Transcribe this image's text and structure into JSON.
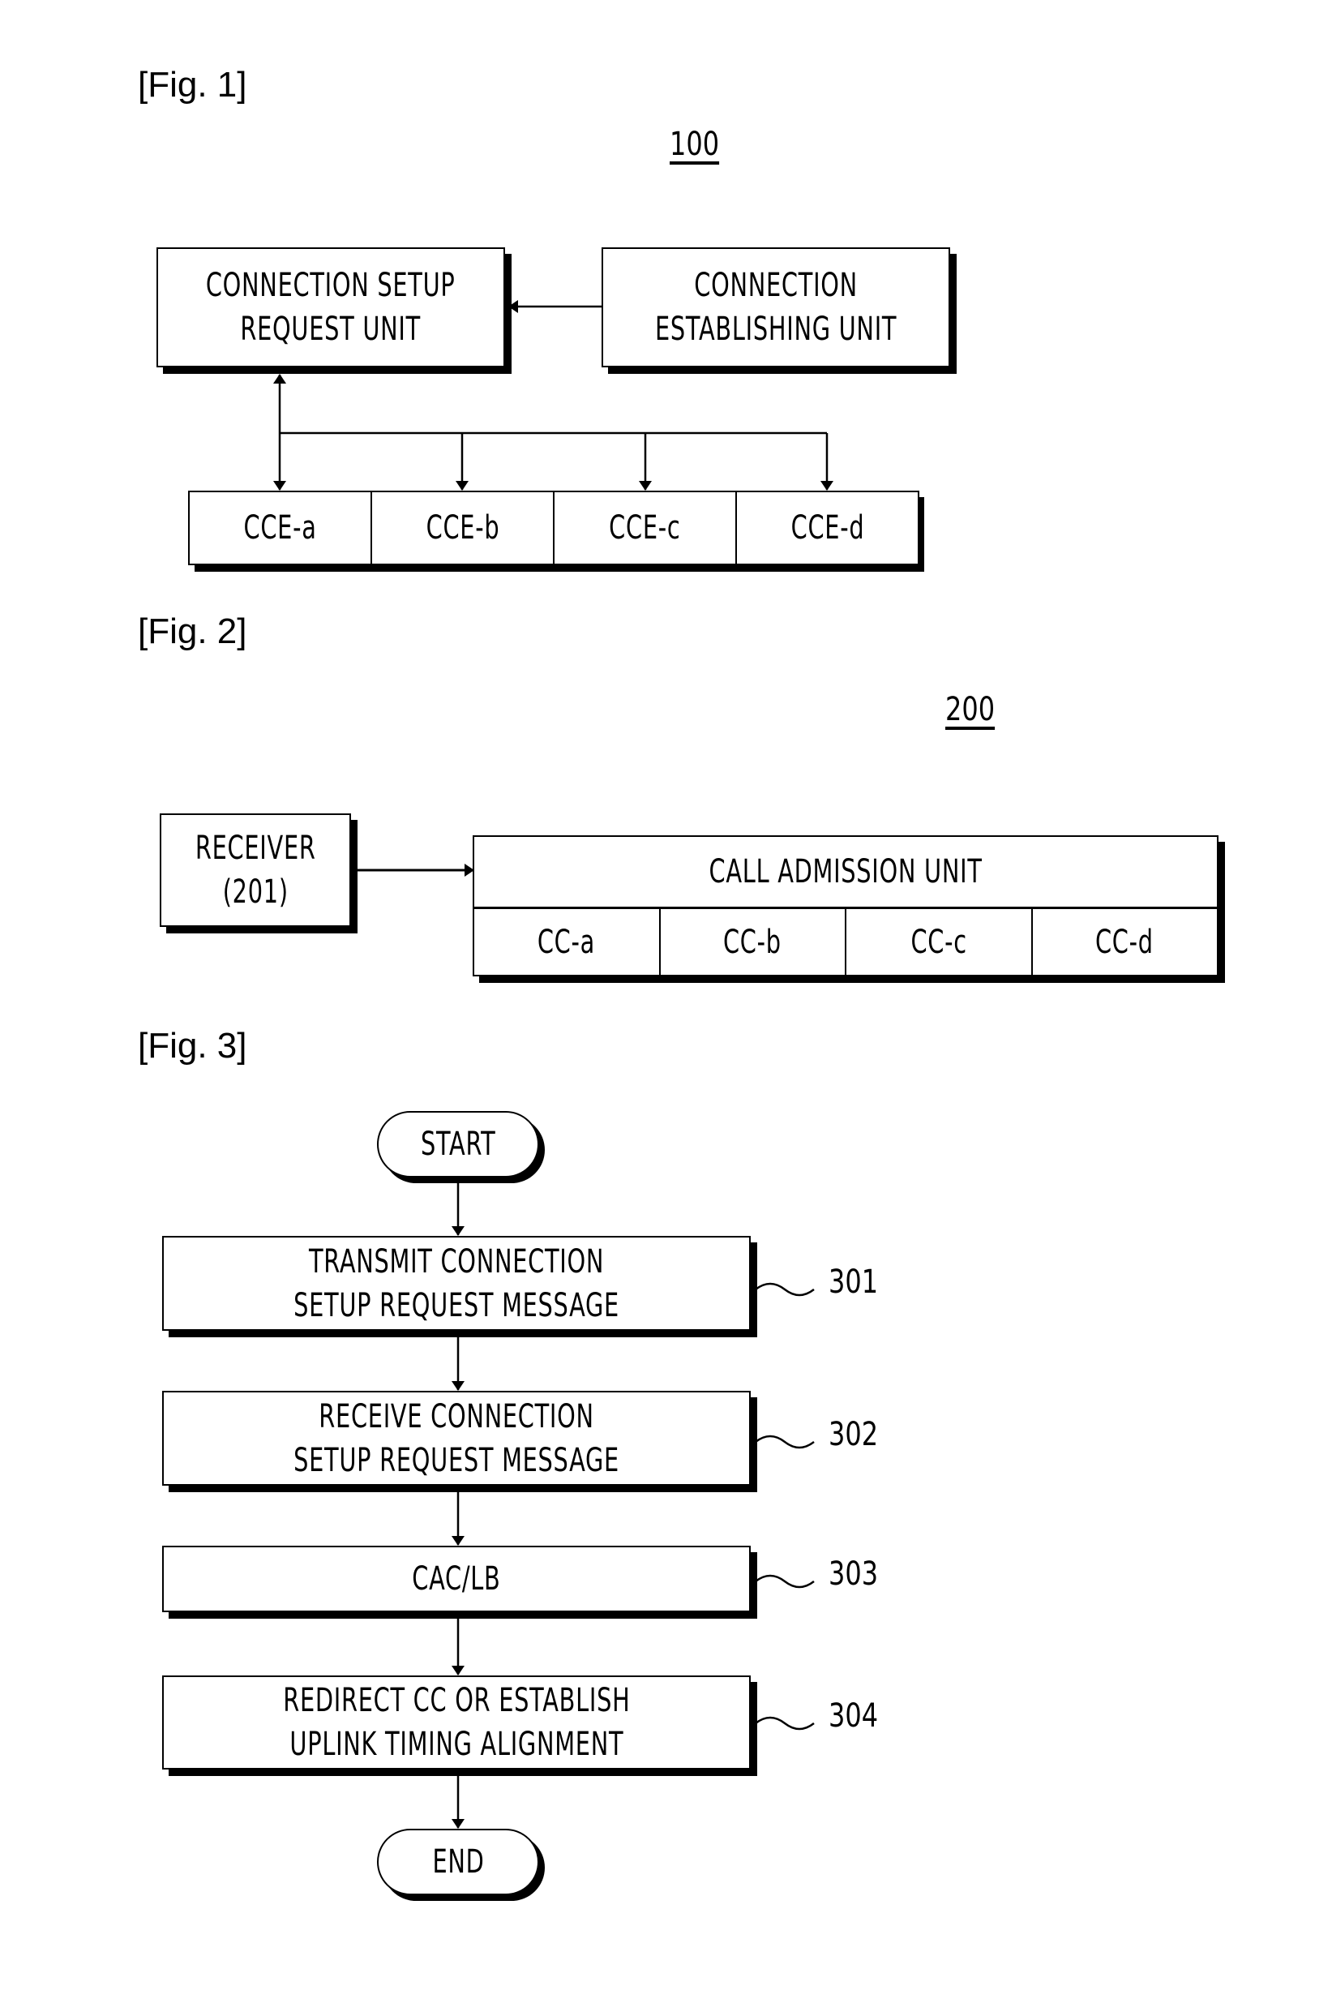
{
  "fig1": {
    "label": "[Fig. 1]",
    "ref": "100",
    "connection_setup_request_unit": [
      "CONNECTION SETUP",
      "REQUEST UNIT"
    ],
    "connection_establishing_unit": [
      "CONNECTION",
      "ESTABLISHING UNIT"
    ],
    "cces": [
      "CCE-a",
      "CCE-b",
      "CCE-c",
      "CCE-d"
    ]
  },
  "fig2": {
    "label": "[Fig. 2]",
    "ref": "200",
    "receiver": [
      "RECEIVER",
      "(201)"
    ],
    "call_admission_unit": "CALL ADMISSION UNIT",
    "ccs": [
      "CC-a",
      "CC-b",
      "CC-c",
      "CC-d"
    ]
  },
  "fig3": {
    "label": "[Fig. 3]",
    "start": "START",
    "end": "END",
    "steps": [
      {
        "lines": [
          "TRANSMIT CONNECTION",
          "SETUP REQUEST MESSAGE"
        ],
        "ref": "301"
      },
      {
        "lines": [
          "RECEIVE CONNECTION",
          "SETUP REQUEST MESSAGE"
        ],
        "ref": "302"
      },
      {
        "lines": [
          "CAC/LB"
        ],
        "ref": "303"
      },
      {
        "lines": [
          "REDIRECT CC OR ESTABLISH",
          "UPLINK TIMING ALIGNMENT"
        ],
        "ref": "304"
      }
    ]
  }
}
